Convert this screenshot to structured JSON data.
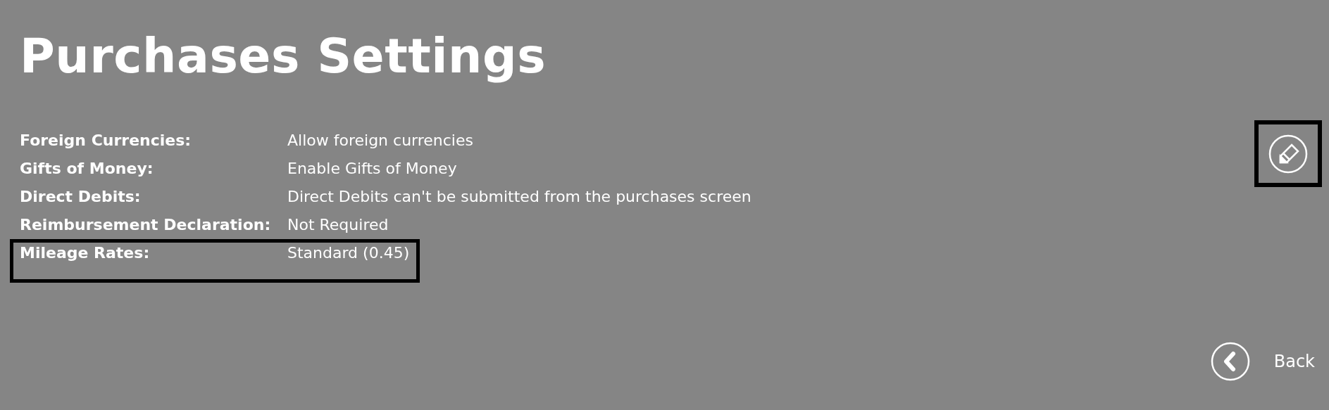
{
  "title": "Purchases Settings",
  "settings": [
    {
      "label": "Foreign Currencies:",
      "value": "Allow foreign currencies",
      "highlighted": false
    },
    {
      "label": "Gifts of Money:",
      "value": "Enable Gifts of Money",
      "highlighted": false
    },
    {
      "label": "Direct Debits:",
      "value": "Direct Debits can't be submitted from the purchases screen",
      "highlighted": false
    },
    {
      "label": "Reimbursement Declaration:",
      "value": "Not Required",
      "highlighted": false
    },
    {
      "label": "Mileage Rates:",
      "value": "Standard (0.45)",
      "highlighted": true
    }
  ],
  "edit_button": {
    "highlighted": true
  },
  "back_button": {
    "label": "Back"
  }
}
